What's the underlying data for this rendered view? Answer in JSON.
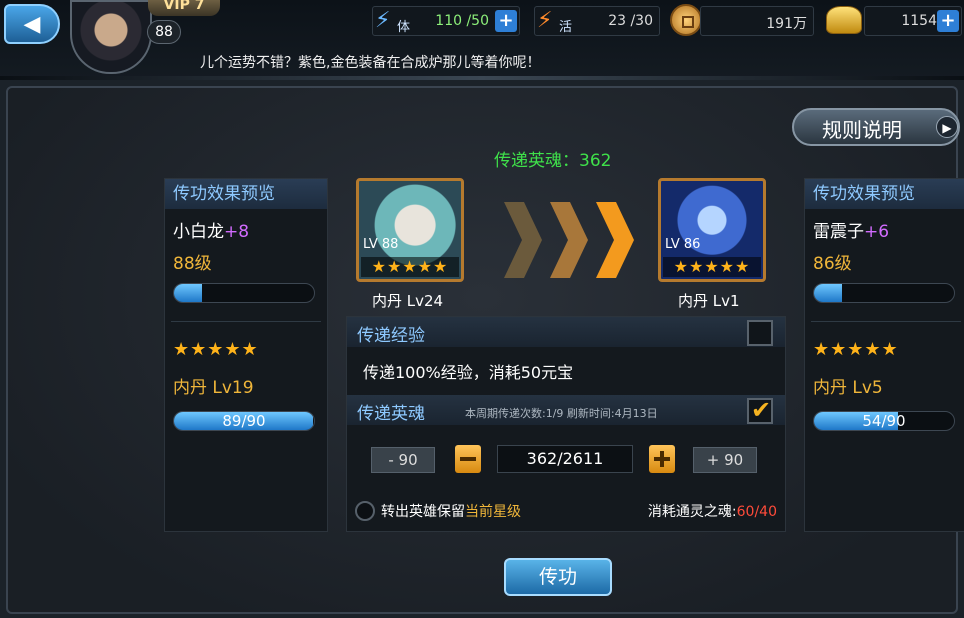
{
  "header": {
    "vip_label": "VIP 7",
    "player_level": "88",
    "stamina": {
      "label": "体",
      "value": "110 /50"
    },
    "vitality": {
      "label": "活",
      "value": "23 /30"
    },
    "coins": "191万",
    "ingots": "1154",
    "marquee": "儿个运势不错？紫色,金色装备在合成炉那儿等着你呢！"
  },
  "rules_button": "规则说明",
  "transfer_soul": "传递英魂：362",
  "left_hero": {
    "panel_title": "传功效果预览",
    "name": "小白龙",
    "plus": "+8",
    "level": "88级",
    "exp_fill": 0.2,
    "stars": "★★★★★",
    "inner_dan": "内丹 Lv19",
    "dan_progress": "89/90",
    "dan_fill": 0.99,
    "card_lv": "LV 88",
    "card_stars": "★★★★★",
    "card_dan": "内丹 Lv24"
  },
  "right_hero": {
    "panel_title": "传功效果预览",
    "name": "雷震子",
    "plus": "+6",
    "level": "86级",
    "exp_fill": 0.2,
    "stars": "★★★★★",
    "inner_dan": "内丹 Lv5",
    "dan_progress": "54/90",
    "dan_fill": 0.6,
    "card_lv": "LV 86",
    "card_stars": "★★★★★",
    "card_dan": "内丹 Lv1"
  },
  "transfer_exp": {
    "title": "传递经验",
    "checked": false,
    "description": "传递100%经验，消耗50元宝"
  },
  "transfer_soul_section": {
    "title": "传递英魂",
    "week_info": "本周期传递次数:1/9 刷新时间:4月13日",
    "checked": true,
    "minus90": "- 90",
    "plus90": "+ 90",
    "amount": "362/2611",
    "keep_prefix": "转出英雄保留",
    "keep_highlight": "当前星级",
    "cost_prefix": "消耗通灵之魂:",
    "cost_value": "60/40"
  },
  "action_button": "传功",
  "colors": {
    "exp_bar": "#1f78c8",
    "accent_gold": "#f0b63a",
    "green_title": "#3fe04a"
  }
}
